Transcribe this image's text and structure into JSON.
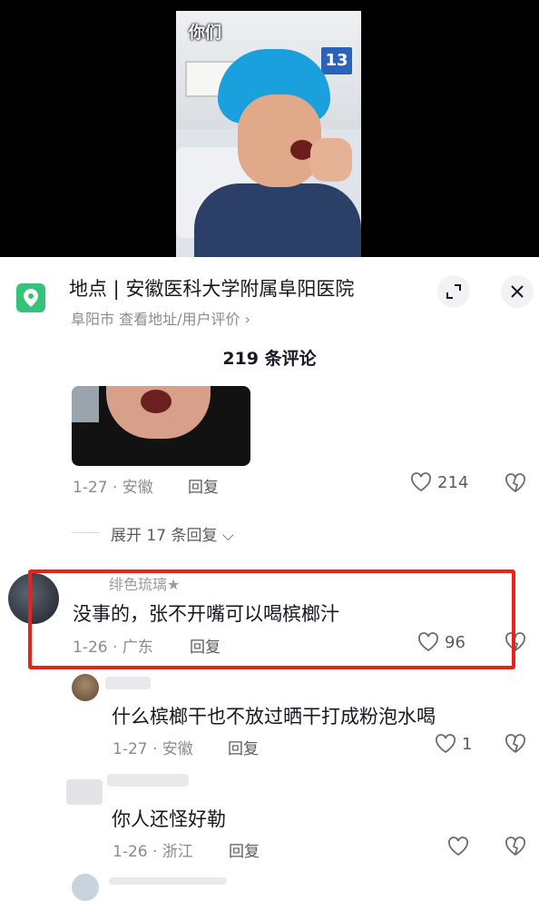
{
  "video": {
    "caption": "你们"
  },
  "location": {
    "title": "地点 | 安徽医科大学附属阜阳医院",
    "subtitle": "阜阳市  查看地址/用户评价 ›"
  },
  "comments_header": {
    "count_label": "219 条评论"
  },
  "comments": [
    {
      "date_region": "1-27 · 安徽",
      "reply": "回复",
      "likes": "214"
    },
    {
      "name": "绯色琉璃★",
      "text": "没事的，张不开嘴可以喝槟榔汁",
      "date_region": "1-26 · 广东",
      "reply": "回复",
      "likes": "96",
      "highlighted": true
    },
    {
      "text": "什么槟榔干也不放过晒干打成粉泡水喝",
      "date_region": "1-27 · 安徽",
      "reply": "回复",
      "likes": "1"
    },
    {
      "text": "你人还怪好勒",
      "date_region": "1-26 · 浙江",
      "reply": "回复",
      "likes": ""
    }
  ],
  "expand": {
    "label": "展开 17 条回复 ⌵"
  },
  "colors": {
    "highlight": "#e8231b",
    "location_icon": "#35c37a"
  },
  "icons": [
    "location-pin-icon",
    "minimize-icon",
    "close-icon",
    "heart-icon",
    "dislike-heart-icon",
    "chevron-down-icon"
  ]
}
